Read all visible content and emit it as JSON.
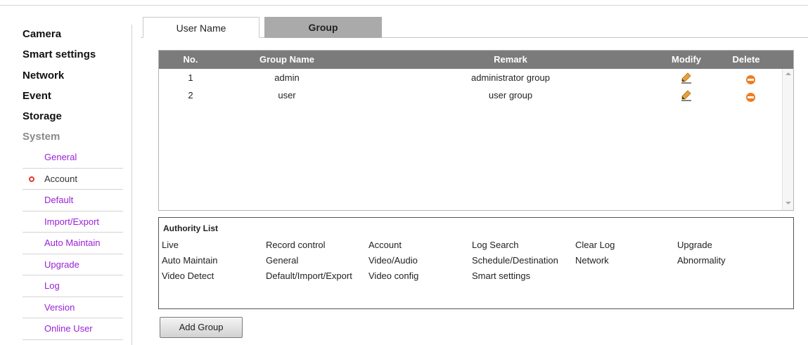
{
  "sidebar": {
    "main": [
      "Camera",
      "Smart settings",
      "Network",
      "Event",
      "Storage",
      "System"
    ],
    "sub": [
      "General",
      "Account",
      "Default",
      "Import/Export",
      "Auto Maintain",
      "Upgrade",
      "Log",
      "Version",
      "Online User"
    ],
    "active_sub": "Account"
  },
  "tabs": [
    "User Name",
    "Group"
  ],
  "table": {
    "headers": [
      "No.",
      "Group Name",
      "Remark",
      "Modify",
      "Delete"
    ],
    "rows": [
      {
        "no": "1",
        "name": "admin",
        "remark": "administrator group"
      },
      {
        "no": "2",
        "name": "user",
        "remark": "user group"
      }
    ]
  },
  "authority": {
    "title": "Authority List",
    "rows": [
      [
        "Live",
        "Record control",
        "Account",
        "Log Search",
        "Clear Log",
        "Upgrade"
      ],
      [
        "Auto Maintain",
        "General",
        "Video/Audio",
        "Schedule/Destination",
        "Network",
        "Abnormality"
      ],
      [
        "Video Detect",
        "Default/Import/Export",
        "Video config",
        "Smart settings"
      ]
    ]
  },
  "add_group_label": "Add Group",
  "colors": {
    "accent": "#9a21d6",
    "header_bg": "#7b7b7b",
    "delete": "#f07c1e",
    "active_dot": "#e23b2e"
  },
  "icons": {
    "modify": "pencil-icon",
    "delete": "delete-icon"
  }
}
